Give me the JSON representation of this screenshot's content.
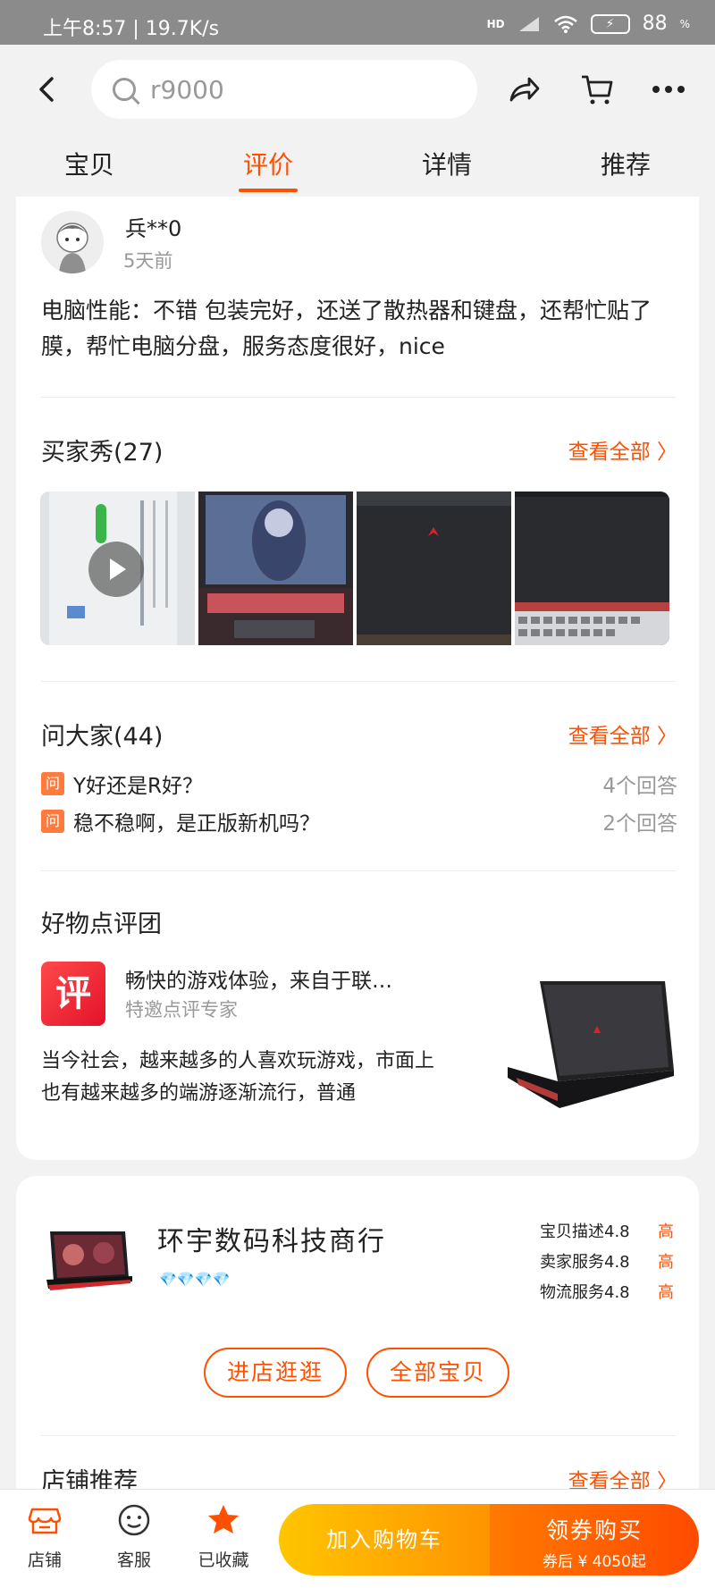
{
  "statusbar": {
    "time": "上午8:57 | 19.7K/s",
    "hd": "HD",
    "battery": "88",
    "battery_unit": "%"
  },
  "search": {
    "value": "r9000"
  },
  "tabs": [
    {
      "label": "宝贝"
    },
    {
      "label": "评价"
    },
    {
      "label": "详情"
    },
    {
      "label": "推荐"
    }
  ],
  "review": {
    "username": "兵**0",
    "time": "5天前",
    "text": "电脑性能：不错 包装完好，还送了散热器和键盘，还帮忙贴了膜，帮忙电脑分盘，服务态度很好，nice"
  },
  "buyer_show": {
    "title": "买家秀(27)",
    "see_all": "查看全部 〉"
  },
  "ask": {
    "title": "问大家(44)",
    "see_all": "查看全部 〉",
    "badge": "问",
    "items": [
      {
        "question": "Y好还是R好？",
        "answers": "4个回答"
      },
      {
        "question": "稳不稳啊，是正版新机吗？",
        "answers": "2个回答"
      }
    ]
  },
  "judges": {
    "title": "好物点评团",
    "logo_char": "评",
    "headline": "畅快的游戏体验，来自于联…",
    "subtitle": "特邀点评专家",
    "text": "当今社会，越来越多的人喜欢玩游戏，市面上也有越来越多的端游逐渐流行，普通"
  },
  "shop": {
    "name": "环宇数码科技商行",
    "diamonds": "💎💎💎💎",
    "ratings": [
      {
        "label": "宝贝描述4.8",
        "level": "高"
      },
      {
        "label": "卖家服务4.8",
        "level": "高"
      },
      {
        "label": "物流服务4.8",
        "level": "高"
      }
    ],
    "enter_btn": "进店逛逛",
    "all_items_btn": "全部宝贝",
    "recommend_title": "店铺推荐",
    "recommend_all": "查看全部 〉"
  },
  "bottombar": {
    "store": "店铺",
    "service": "客服",
    "favorited": "已收藏",
    "add_cart": "加入购物车",
    "buy_main": "领券购买",
    "buy_sub": "券后 ¥ 4050起"
  },
  "colors": {
    "accent": "#ff5000",
    "cart_gradient": [
      "#ffc500",
      "#ff9400"
    ],
    "buy_gradient": [
      "#ff7a00",
      "#ff4a00"
    ]
  }
}
